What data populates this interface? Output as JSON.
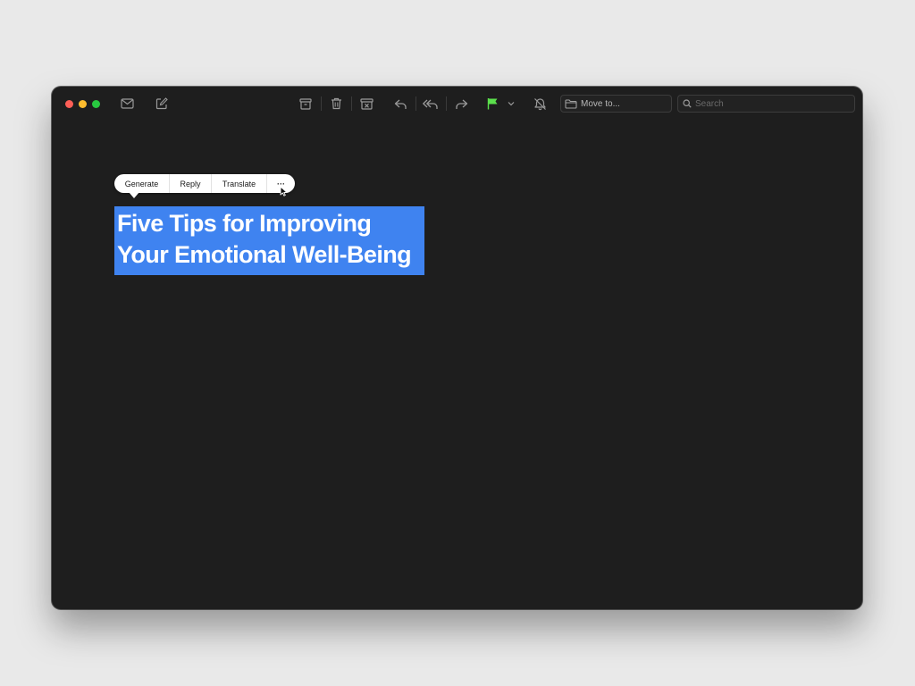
{
  "colors": {
    "desktop": "#e9e9e9",
    "window_bg": "#1e1e1e",
    "close": "#fe5f57",
    "minimize": "#febc2e",
    "zoom": "#28c840",
    "flag": "#5be04c",
    "selection": "#3f83f0",
    "icon": "#9a9a9a"
  },
  "toolbar": {
    "icons": [
      "mailbox-icon",
      "compose-icon",
      "archive-icon",
      "trash-icon",
      "junk-icon",
      "reply-icon",
      "reply-all-icon",
      "forward-icon",
      "flag-icon",
      "chevron-down-icon",
      "mute-bell-icon",
      "folder-icon",
      "search-icon"
    ],
    "move_to_label": "Move to...",
    "search_placeholder": "Search"
  },
  "popup_menu": {
    "items": [
      {
        "label": "Generate"
      },
      {
        "label": "Reply"
      },
      {
        "label": "Translate"
      },
      {
        "label": "···"
      }
    ]
  },
  "document": {
    "heading_lines": [
      "Five Tips for Improving",
      "Your Emotional Well-Being"
    ]
  }
}
